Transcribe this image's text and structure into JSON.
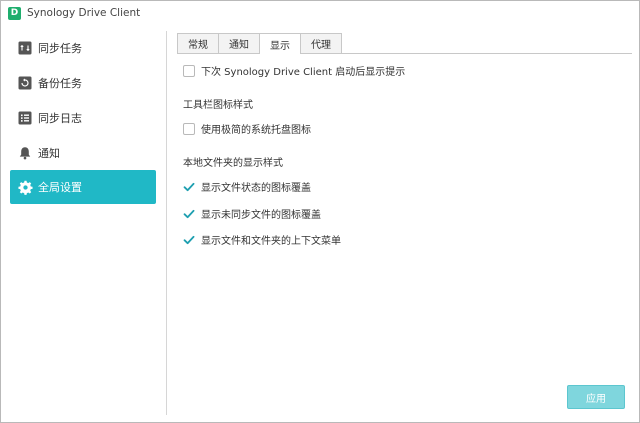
{
  "window": {
    "title": "Synology Drive Client",
    "logo_letter": "D"
  },
  "sidebar": {
    "items": [
      {
        "label": "同步任务",
        "icon": "sync-task-icon"
      },
      {
        "label": "备份任务",
        "icon": "backup-task-icon"
      },
      {
        "label": "同步日志",
        "icon": "sync-log-icon"
      },
      {
        "label": "通知",
        "icon": "bell-icon"
      },
      {
        "label": "全局设置",
        "icon": "gear-icon",
        "active": true
      }
    ]
  },
  "tabs": [
    {
      "label": "常规"
    },
    {
      "label": "通知"
    },
    {
      "label": "显示",
      "active": true
    },
    {
      "label": "代理"
    }
  ],
  "display": {
    "startup_hint": {
      "label": "下次 Synology Drive Client 启动后显示提示",
      "checked": false
    },
    "toolbar_section_title": "工具栏图标样式",
    "simple_tray_icon": {
      "label": "使用极简的系统托盘图标",
      "checked": false
    },
    "local_section_title": "本地文件夹的显示样式",
    "file_status_overlay": {
      "label": "显示文件状态的图标覆盖",
      "checked": true
    },
    "unsynced_overlay": {
      "label": "显示未同步文件的图标覆盖",
      "checked": true
    },
    "context_menu": {
      "label": "显示文件和文件夹的上下文菜单",
      "checked": true
    }
  },
  "footer": {
    "apply_label": "应用"
  },
  "colors": {
    "accent": "#20b8c6",
    "check": "#1e9fb0",
    "logo": "#1fae6e"
  }
}
